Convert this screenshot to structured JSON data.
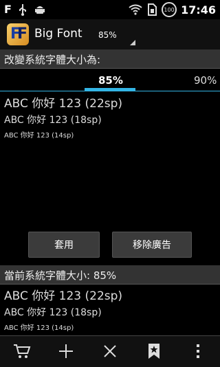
{
  "status_bar": {
    "time": "17:46",
    "left_letter": "F",
    "badge_text": "100"
  },
  "app": {
    "title": "Big Font",
    "spinner_value": "85%"
  },
  "change_section": {
    "header": "改變系統字體大小為:"
  },
  "tabs": {
    "selected": "85%",
    "next": "90%"
  },
  "samples_top": {
    "s22": "ABC 你好 123 (22sp)",
    "s18": "ABC 你好 123 (18sp)",
    "s14": "ABC 你好 123 (14sp)"
  },
  "buttons": {
    "apply": "套用",
    "remove_ads": "移除廣告"
  },
  "current_section": {
    "header": "當前系統字體大小: 85%"
  },
  "samples_bottom": {
    "s22": "ABC 你好 123 (22sp)",
    "s18": "ABC 你好 123 (18sp)",
    "s14": "ABC 你好 123 (14sp)"
  },
  "bottom_bar": {
    "icons": [
      "cart-icon",
      "add-icon",
      "close-icon",
      "bookmark-icon",
      "overflow-menu-icon"
    ]
  }
}
